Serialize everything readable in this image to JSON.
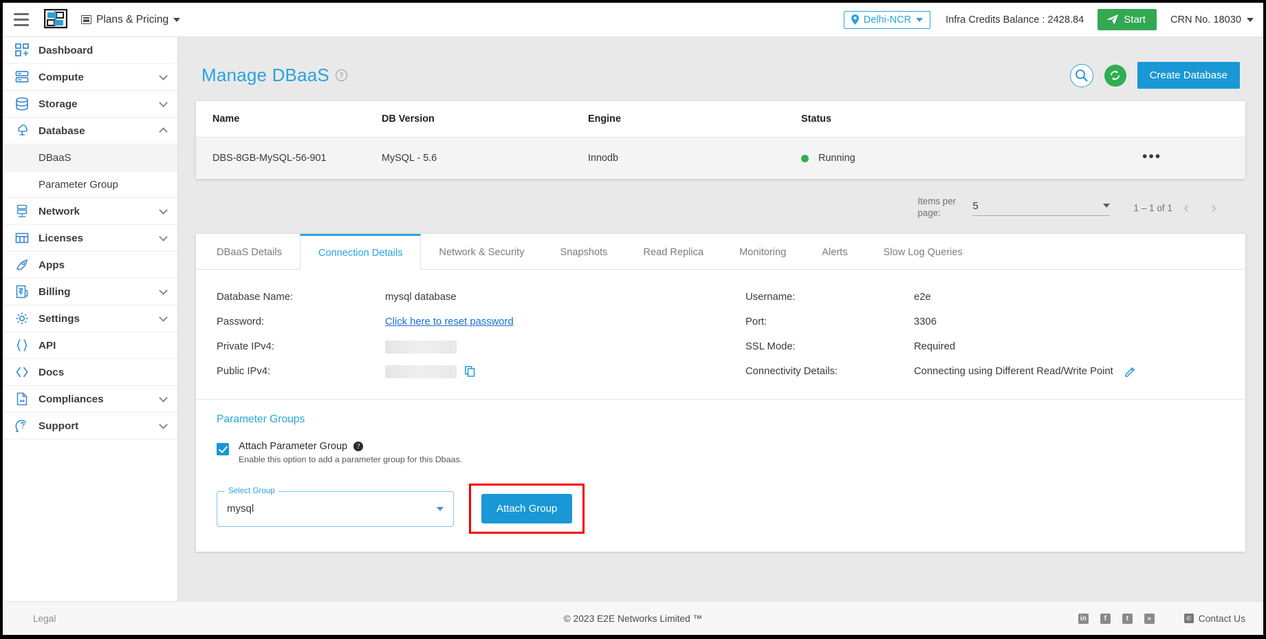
{
  "topbar": {
    "menu_icon": "hamburger-icon",
    "logo_alt": "E2E Networks",
    "logo_caption": "E2E Networks",
    "plans_label": "Plans & Pricing",
    "region_label": "Delhi-NCR",
    "credits_label": "Infra Credits Balance : 2428.84",
    "start_label": "Start",
    "crn_label": "CRN No. 18030"
  },
  "sidebar": {
    "items": [
      {
        "label": "Dashboard",
        "icon": "dashboard-icon",
        "expandable": false
      },
      {
        "label": "Compute",
        "icon": "compute-icon",
        "expandable": true
      },
      {
        "label": "Storage",
        "icon": "storage-icon",
        "expandable": true
      },
      {
        "label": "Database",
        "icon": "database-icon",
        "expandable": true,
        "expanded": true
      },
      {
        "label": "Network",
        "icon": "network-icon",
        "expandable": true
      },
      {
        "label": "Licenses",
        "icon": "licenses-icon",
        "expandable": true
      },
      {
        "label": "Apps",
        "icon": "apps-icon",
        "expandable": false
      },
      {
        "label": "Billing",
        "icon": "billing-icon",
        "expandable": true
      },
      {
        "label": "Settings",
        "icon": "settings-icon",
        "expandable": true
      },
      {
        "label": "API",
        "icon": "api-icon",
        "expandable": false
      },
      {
        "label": "Docs",
        "icon": "docs-icon",
        "expandable": false
      },
      {
        "label": "Compliances",
        "icon": "compliances-icon",
        "expandable": true
      },
      {
        "label": "Support",
        "icon": "support-icon",
        "expandable": true
      }
    ],
    "database_subitems": [
      {
        "label": "DBaaS",
        "active": true
      },
      {
        "label": "Parameter Group",
        "active": false
      }
    ]
  },
  "page": {
    "title": "Manage DBaaS",
    "help_icon": "help-circle-icon",
    "search_icon": "search-icon",
    "refresh_icon": "refresh-icon",
    "create_button": "Create Database"
  },
  "table": {
    "headers": [
      "Name",
      "DB Version",
      "Engine",
      "Status",
      ""
    ],
    "rows": [
      {
        "name": "DBS-8GB-MySQL-56-901",
        "db_version": "MySQL - 5.6",
        "engine": "Innodb",
        "status": "Running",
        "status_color": "#2fae52",
        "menu": "•••"
      }
    ]
  },
  "paginator": {
    "items_per_page_label": "Items per page:",
    "items_per_page_value": "5",
    "range_label": "1 – 1 of 1",
    "prev_icon": "chevron-left-icon",
    "next_icon": "chevron-right-icon"
  },
  "tabs": [
    {
      "label": "DBaaS Details",
      "active": false
    },
    {
      "label": "Connection Details",
      "active": true
    },
    {
      "label": "Network & Security",
      "active": false
    },
    {
      "label": "Snapshots",
      "active": false
    },
    {
      "label": "Read Replica",
      "active": false
    },
    {
      "label": "Monitoring",
      "active": false
    },
    {
      "label": "Alerts",
      "active": false
    },
    {
      "label": "Slow Log Queries",
      "active": false
    }
  ],
  "connection_details": {
    "left": [
      {
        "label": "Database Name:",
        "value": "mysql database",
        "type": "text"
      },
      {
        "label": "Password:",
        "value": "Click here to reset password",
        "type": "link"
      },
      {
        "label": "Private IPv4:",
        "value": "",
        "type": "redacted"
      },
      {
        "label": "Public IPv4:",
        "value": "",
        "type": "redacted-copy"
      }
    ],
    "right": [
      {
        "label": "Username:",
        "value": "e2e",
        "type": "text"
      },
      {
        "label": "Port:",
        "value": "3306",
        "type": "text"
      },
      {
        "label": "SSL Mode:",
        "value": "Required",
        "type": "text"
      },
      {
        "label": "Connectivity Details:",
        "value": "Connecting using Different Read/Write Point",
        "type": "text-edit"
      }
    ]
  },
  "parameter_groups": {
    "section_title": "Parameter Groups",
    "checkbox_label": "Attach Parameter Group",
    "checkbox_help_icon": "help-filled-icon",
    "checkbox_checked": true,
    "checkbox_sub": "Enable this option to add a parameter group for this Dbaas.",
    "select_legend": "Select Group",
    "select_value": "mysql",
    "attach_button": "Attach Group",
    "highlight_color": "#f40000"
  },
  "footer": {
    "legal": "Legal",
    "copyright": "© 2023 E2E Networks Limited ™",
    "social": [
      {
        "name": "linkedin-icon",
        "glyph": "in"
      },
      {
        "name": "facebook-icon",
        "glyph": "f"
      },
      {
        "name": "twitter-icon",
        "glyph": "t"
      },
      {
        "name": "rss-icon",
        "glyph": "»"
      }
    ],
    "contact": "Contact Us"
  }
}
